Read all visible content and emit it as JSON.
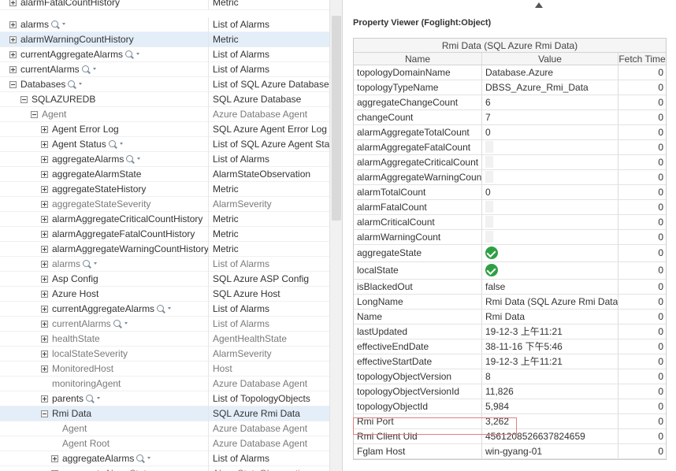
{
  "tree": {
    "rows": [
      {
        "name": "alarmFatalCountHistory",
        "type": "Metric"
      },
      {
        "name": "alarms",
        "type": "List of Alarms"
      },
      {
        "name": "alarmWarningCountHistory",
        "type": "Metric"
      },
      {
        "name": "currentAggregateAlarms",
        "type": "List of Alarms"
      },
      {
        "name": "currentAlarms",
        "type": "List of Alarms"
      },
      {
        "name": "Databases",
        "type": "List of SQL Azure Databases"
      },
      {
        "name": "SQLAZUREDB",
        "type": "SQL Azure Database"
      },
      {
        "name": "Agent",
        "type": "Azure Database Agent"
      },
      {
        "name": "Agent Error Log",
        "type": "SQL Azure Agent Error Log D"
      },
      {
        "name": "Agent Status",
        "type": "List of SQL Azure Agent Stat"
      },
      {
        "name": "aggregateAlarms",
        "type": "List of Alarms"
      },
      {
        "name": "aggregateAlarmState",
        "type": "AlarmStateObservation"
      },
      {
        "name": "aggregateStateHistory",
        "type": "Metric"
      },
      {
        "name": "aggregateStateSeverity",
        "type": "AlarmSeverity"
      },
      {
        "name": "alarmAggregateCriticalCountHistory",
        "type": "Metric"
      },
      {
        "name": "alarmAggregateFatalCountHistory",
        "type": "Metric"
      },
      {
        "name": "alarmAggregateWarningCountHistory",
        "type": "Metric"
      },
      {
        "name": "alarms",
        "type": "List of Alarms"
      },
      {
        "name": "Asp Config",
        "type": "SQL Azure ASP Config"
      },
      {
        "name": "Azure Host",
        "type": "SQL Azure Host"
      },
      {
        "name": "currentAggregateAlarms",
        "type": "List of Alarms"
      },
      {
        "name": "currentAlarms",
        "type": "List of Alarms"
      },
      {
        "name": "healthState",
        "type": "AgentHealthState"
      },
      {
        "name": "localStateSeverity",
        "type": "AlarmSeverity"
      },
      {
        "name": "MonitoredHost",
        "type": "Host"
      },
      {
        "name": "monitoringAgent",
        "type": "Azure Database Agent"
      },
      {
        "name": "parents",
        "type": "List of TopologyObjects"
      },
      {
        "name": "Rmi Data",
        "type": "SQL Azure Rmi Data"
      },
      {
        "name": "Agent",
        "type": "Azure Database Agent"
      },
      {
        "name": "Agent Root",
        "type": "Azure Database Agent"
      },
      {
        "name": "aggregateAlarms",
        "type": "List of Alarms"
      },
      {
        "name": "aggregateAlarmState",
        "type": "AlarmStateObservation"
      }
    ]
  },
  "property_viewer": {
    "title": "Property Viewer (Foglight:Object)",
    "caption": "Rmi Data (SQL Azure Rmi Data)",
    "columns": {
      "name": "Name",
      "value": "Value",
      "fetch": "Fetch Time"
    },
    "rows": [
      {
        "name": "topologyDomainName",
        "value": "Database.Azure",
        "fetch": "0"
      },
      {
        "name": "topologyTypeName",
        "value": "DBSS_Azure_Rmi_Data",
        "fetch": "0"
      },
      {
        "name": "aggregateChangeCount",
        "value": "6",
        "fetch": "0"
      },
      {
        "name": "changeCount",
        "value": "7",
        "fetch": "0"
      },
      {
        "name": "alarmAggregateTotalCount",
        "value": "0",
        "fetch": "0"
      },
      {
        "name": "alarmAggregateFatalCount",
        "value": "",
        "fetch": "0"
      },
      {
        "name": "alarmAggregateCriticalCount",
        "value": "",
        "fetch": "0"
      },
      {
        "name": "alarmAggregateWarningCount",
        "value": "",
        "fetch": "0"
      },
      {
        "name": "alarmTotalCount",
        "value": "0",
        "fetch": "0"
      },
      {
        "name": "alarmFatalCount",
        "value": "",
        "fetch": "0"
      },
      {
        "name": "alarmCriticalCount",
        "value": "",
        "fetch": "0"
      },
      {
        "name": "alarmWarningCount",
        "value": "",
        "fetch": "0"
      },
      {
        "name": "aggregateState",
        "value": "",
        "icon": "check-circle-icon",
        "fetch": "0"
      },
      {
        "name": "localState",
        "value": "",
        "icon": "check-circle-icon",
        "fetch": "0"
      },
      {
        "name": "isBlackedOut",
        "value": "false",
        "fetch": "0"
      },
      {
        "name": "LongName",
        "value": "Rmi Data (SQL Azure Rmi Data)",
        "fetch": "0"
      },
      {
        "name": "Name",
        "value": "Rmi Data",
        "fetch": "0"
      },
      {
        "name": "lastUpdated",
        "value": "19-12-3 上午11:21",
        "fetch": "0"
      },
      {
        "name": "effectiveEndDate",
        "value": "38-11-16 下午5:46",
        "fetch": "0"
      },
      {
        "name": "effectiveStartDate",
        "value": "19-12-3 上午11:21",
        "fetch": "0"
      },
      {
        "name": "topologyObjectVersion",
        "value": "8",
        "fetch": "0"
      },
      {
        "name": "topologyObjectVersionId",
        "value": "11,826",
        "fetch": "0"
      },
      {
        "name": "topologyObjectId",
        "value": "5,984",
        "fetch": "0"
      },
      {
        "name": "Rmi Port",
        "value": "3,262",
        "fetch": "0"
      },
      {
        "name": "Rmi Client Uid",
        "value": "4561208526637824659",
        "fetch": "0"
      },
      {
        "name": "Fglam Host",
        "value": "win-gyang-01",
        "fetch": "0"
      }
    ]
  },
  "colors": {
    "selected_row": "#e3eef9",
    "highlight_box": "#e08080",
    "ok_icon": "#2ea043"
  }
}
